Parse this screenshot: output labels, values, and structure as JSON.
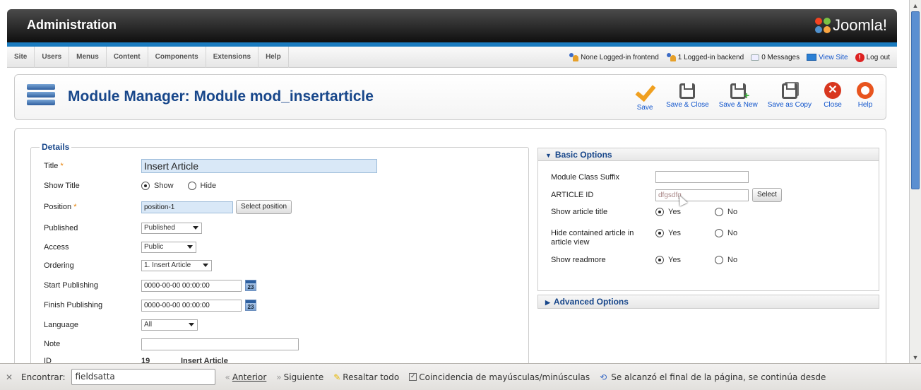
{
  "header": {
    "title": "Administration",
    "logo_text": "Joomla!"
  },
  "menu": {
    "items": [
      "Site",
      "Users",
      "Menus",
      "Content",
      "Components",
      "Extensions",
      "Help"
    ],
    "status": {
      "frontend": "None Logged-in frontend",
      "backend": "1 Logged-in backend",
      "messages": "0 Messages",
      "view_site": "View Site",
      "logout": "Log out"
    }
  },
  "toolbar": {
    "title": "Module Manager: Module mod_insertarticle",
    "buttons": {
      "save": "Save",
      "save_close": "Save & Close",
      "save_new": "Save & New",
      "save_copy": "Save as Copy",
      "close": "Close",
      "help": "Help"
    }
  },
  "details": {
    "legend": "Details",
    "title_label": "Title",
    "title_value": "Insert Article",
    "show_title_label": "Show Title",
    "show_title_opts": [
      "Show",
      "Hide"
    ],
    "position_label": "Position",
    "position_value": "position-1",
    "select_position": "Select position",
    "published_label": "Published",
    "published_value": "Published",
    "access_label": "Access",
    "access_value": "Public",
    "ordering_label": "Ordering",
    "ordering_value": "1. Insert Article",
    "start_label": "Start Publishing",
    "start_value": "0000-00-00 00:00:00",
    "finish_label": "Finish Publishing",
    "finish_value": "0000-00-00 00:00:00",
    "calendar_day": "23",
    "language_label": "Language",
    "language_value": "All",
    "note_label": "Note",
    "note_value": "",
    "id_label": "ID",
    "id_value": "19",
    "id_name": "Insert Article",
    "required_mark": "*"
  },
  "basic_options": {
    "header": "Basic Options",
    "class_suffix_label": "Module Class Suffix",
    "class_suffix_value": "",
    "article_id_label": "ARTICLE ID",
    "article_id_value": "dfgsdfg",
    "select": "Select",
    "show_title_label": "Show article title",
    "hide_contained_label": "Hide contained article in article view",
    "show_readmore_label": "Show readmore",
    "yes": "Yes",
    "no": "No"
  },
  "advanced_options": {
    "header": "Advanced Options"
  },
  "findbar": {
    "label": "Encontrar:",
    "query": "fieldsatta",
    "prev": "Anterior",
    "next": "Siguiente",
    "highlight": "Resaltar todo",
    "match_case": "Coincidencia de mayúsculas/minúsculas",
    "info": "Se alcanzó el final de la página, se continúa desde"
  }
}
